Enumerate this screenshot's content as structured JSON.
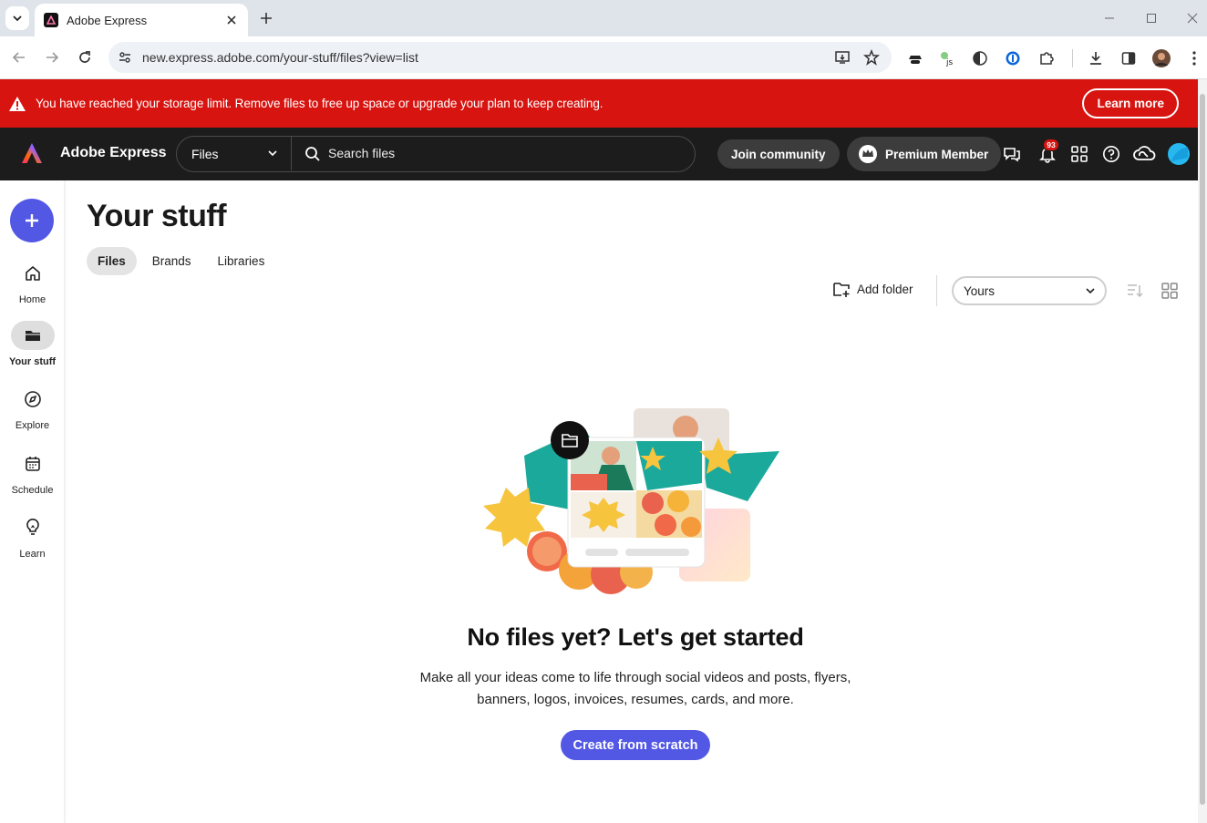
{
  "browser": {
    "tab_title": "Adobe Express",
    "url": "new.express.adobe.com/your-stuff/files?view=list"
  },
  "banner": {
    "message": "You have reached your storage limit. Remove files to free up space or upgrade your plan to keep creating.",
    "learn_more": "Learn more",
    "color": "#d7140f"
  },
  "header": {
    "brand": "Adobe Express",
    "search_scope": "Files",
    "search_placeholder": "Search files",
    "join_community": "Join community",
    "premium": "Premium Member",
    "notification_count": "93"
  },
  "rail": {
    "items": [
      {
        "label": "Home",
        "icon": "home-icon"
      },
      {
        "label": "Your stuff",
        "icon": "folder-icon"
      },
      {
        "label": "Explore",
        "icon": "compass-icon"
      },
      {
        "label": "Schedule",
        "icon": "calendar-icon"
      },
      {
        "label": "Learn",
        "icon": "lightbulb-icon"
      }
    ]
  },
  "main": {
    "title": "Your stuff",
    "tabs": [
      "Files",
      "Brands",
      "Libraries"
    ],
    "add_folder": "Add folder",
    "filter_value": "Yours",
    "empty_title": "No files yet? Let's get started",
    "empty_desc": "Make all your ideas come to life through social videos and posts, flyers, banners, logos, invoices, resumes, cards, and more.",
    "cta": "Create from scratch",
    "accent": "#5258e4"
  }
}
